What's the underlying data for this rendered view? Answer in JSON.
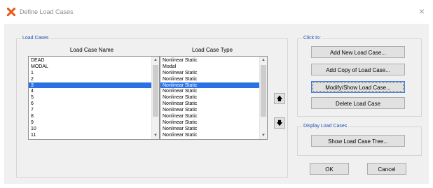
{
  "window": {
    "title": "Define Load Cases",
    "close_glyph": "×"
  },
  "load_cases_group": {
    "label": "Load Cases",
    "name_header": "Load Case Name",
    "type_header": "Load Case Type",
    "rows": [
      {
        "name": "DEAD",
        "type": "Nonlinear Static"
      },
      {
        "name": "MODAL",
        "type": "Modal"
      },
      {
        "name": "1",
        "type": "Nonlinear Static"
      },
      {
        "name": "2",
        "type": "Nonlinear Static"
      },
      {
        "name": "3",
        "type": "Nonlinear Static"
      },
      {
        "name": "4",
        "type": "Nonlinear Static"
      },
      {
        "name": "5",
        "type": "Nonlinear Static"
      },
      {
        "name": "6",
        "type": "Nonlinear Static"
      },
      {
        "name": "7",
        "type": "Nonlinear Static"
      },
      {
        "name": "8",
        "type": "Nonlinear Static"
      },
      {
        "name": "9",
        "type": "Nonlinear Static"
      },
      {
        "name": "10",
        "type": "Nonlinear Static"
      },
      {
        "name": "11",
        "type": "Nonlinear Static"
      }
    ],
    "selected_index": 4,
    "move_up_glyph": "🡅",
    "move_down_glyph": "🡇"
  },
  "click_to_group": {
    "label": "Click to:",
    "add_new": "Add New Load Case...",
    "add_copy": "Add Copy of Load Case...",
    "modify_show": "Modify/Show Load Case...",
    "delete": "Delete Load Case"
  },
  "display_group": {
    "label": "Display Load Cases",
    "show_tree": "Show Load Case Tree..."
  },
  "footer": {
    "ok": "OK",
    "cancel": "Cancel"
  },
  "colors": {
    "accent": "#1f4fb4",
    "selection": "#2a72e4",
    "app_icon": "#e8591a"
  }
}
